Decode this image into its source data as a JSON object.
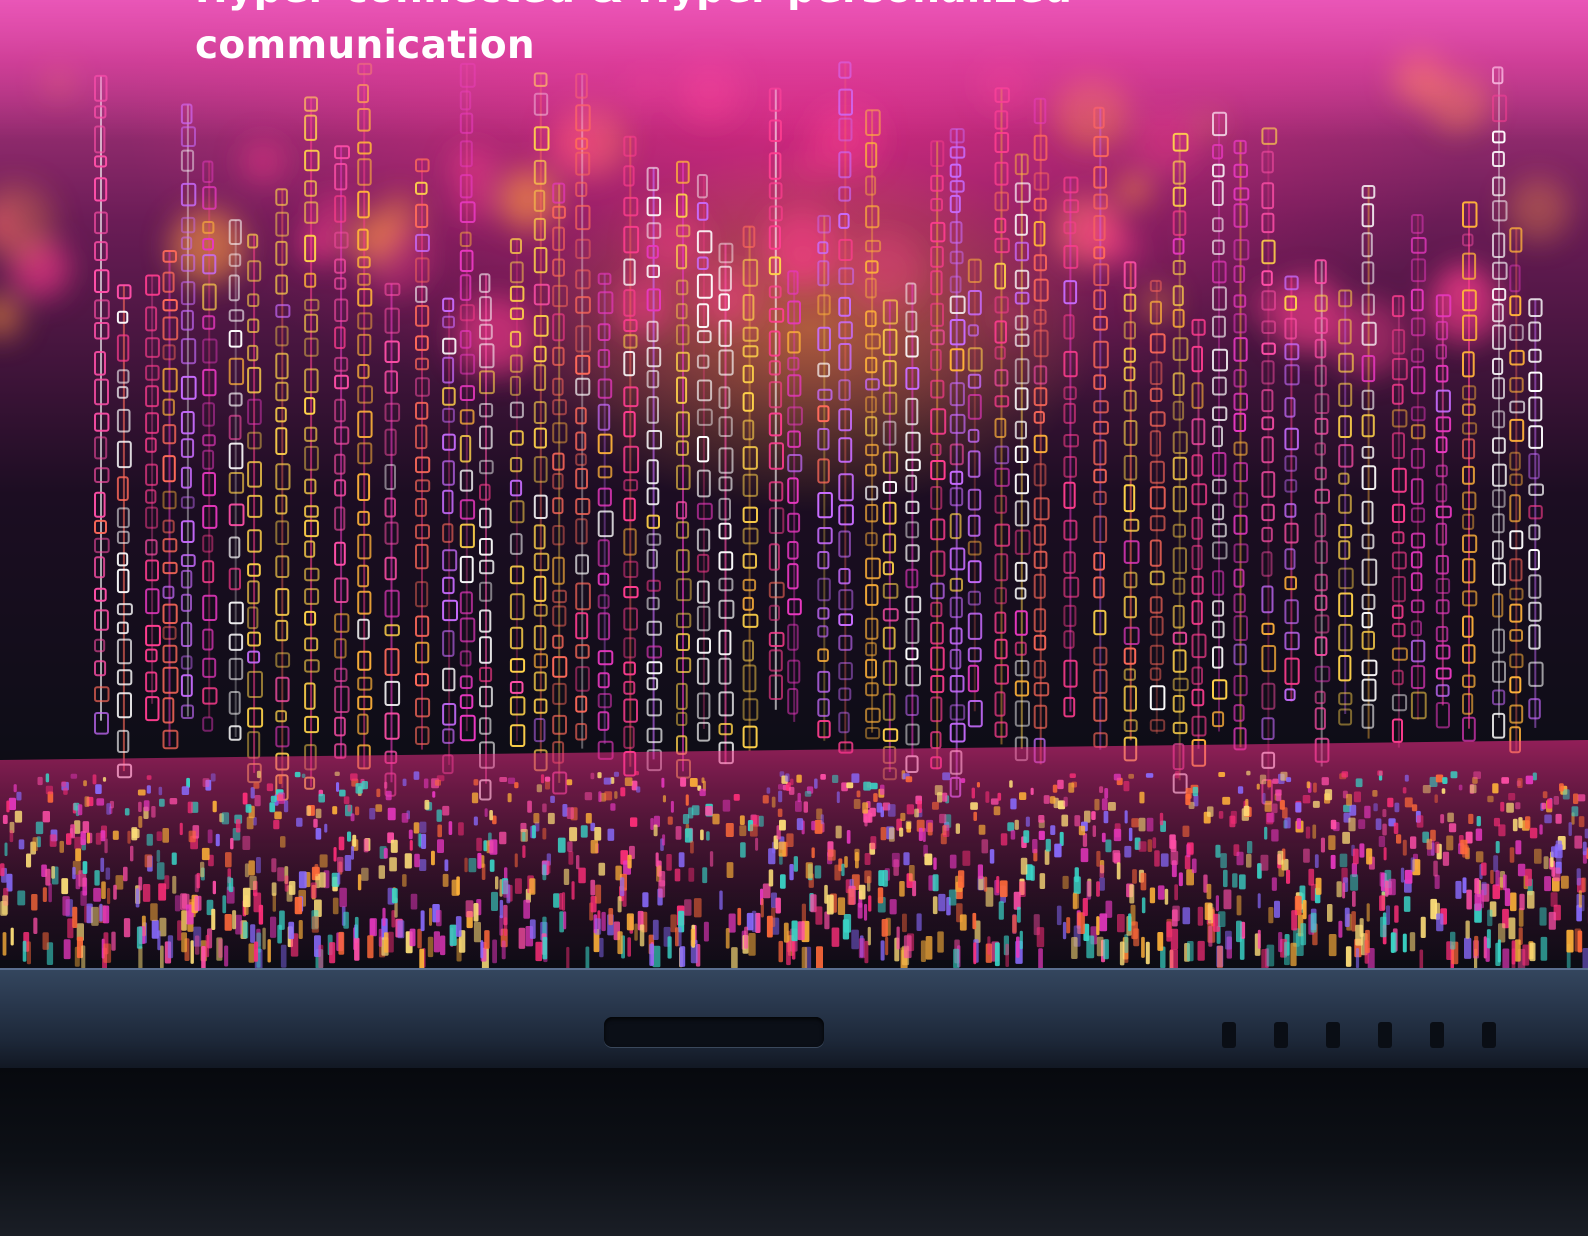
{
  "headline": {
    "line1": "Hyper-connected & Hyper-personalized",
    "line2": "communication"
  },
  "colors": {
    "accent_magenta": "#e0309a",
    "accent_orange": "#ffb23a",
    "headline_text": "#ffffff"
  },
  "image": {
    "subject": "digital-data-rain-over-device-icon"
  }
}
